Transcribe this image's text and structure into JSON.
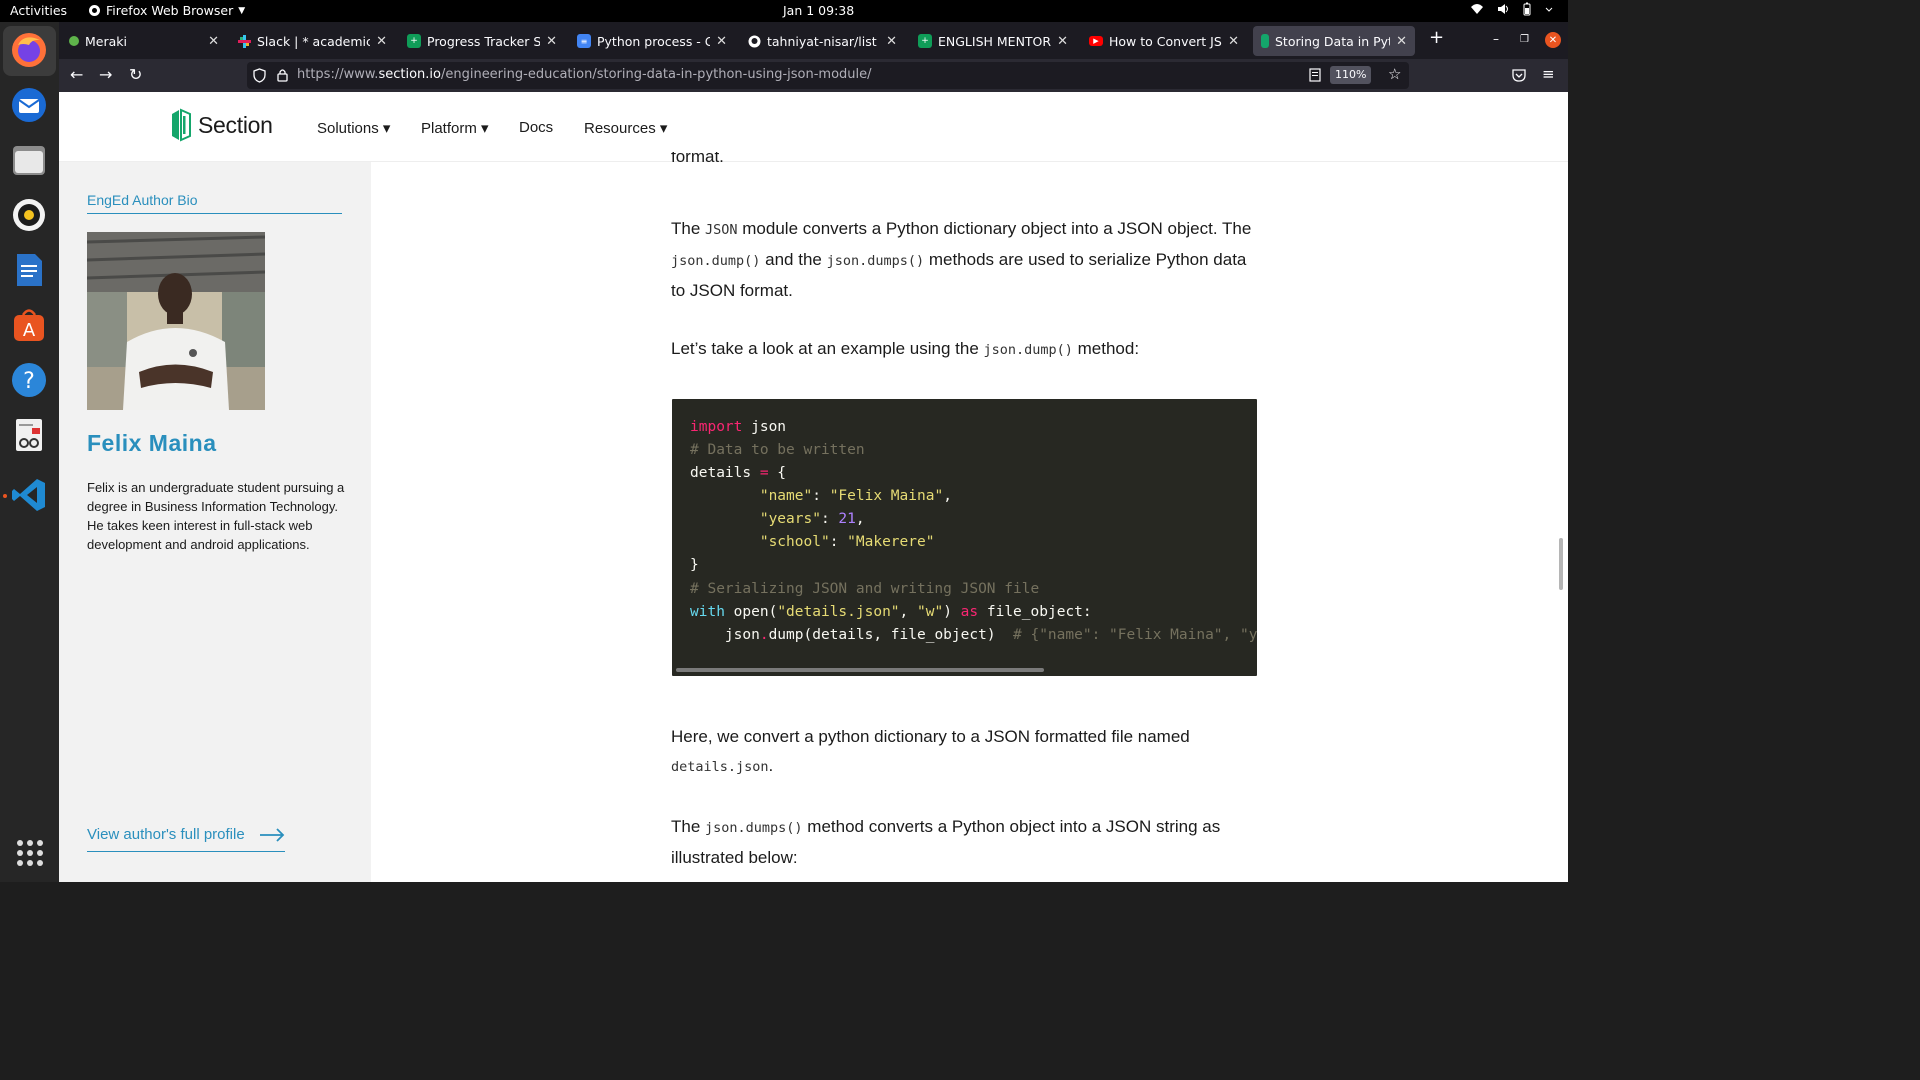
{
  "topbar": {
    "activities": "Activities",
    "app_menu": "Firefox Web Browser",
    "clock": "Jan 1  09:38"
  },
  "tabs": [
    {
      "label": "Meraki",
      "favicon_color": "#5fb44b"
    },
    {
      "label": "Slack | * academics | N",
      "favicon_color": "#e01e5a"
    },
    {
      "label": "Progress Tracker Shee",
      "favicon_color": "#0f9d58"
    },
    {
      "label": "Python process - Goog",
      "favicon_color": "#4285f4"
    },
    {
      "label": "tahniyat-nisar/list",
      "favicon_color": "#ffffff"
    },
    {
      "label": "ENGLISH MENTOR GR",
      "favicon_color": "#0f9d58"
    },
    {
      "label": "How to Convert JSON",
      "favicon_color": "#ff0000"
    },
    {
      "label": "Storing Data in Python",
      "favicon_color": "#14a66b"
    }
  ],
  "navbar": {
    "url_scheme": "https://www.",
    "url_host": "section.io",
    "url_path": "/engineering-education/storing-data-in-python-using-json-module/",
    "zoom": "110%"
  },
  "site": {
    "logo": "Section",
    "menu": {
      "solutions": "Solutions ▾",
      "platform": "Platform ▾",
      "docs": "Docs",
      "resources": "Resources ▾"
    }
  },
  "sidebar": {
    "bio_label": "EngEd Author Bio",
    "author_name": "Felix Maina",
    "author_bio": "Felix is an undergraduate student pursuing a degree in Business Information Technology. He takes keen interest in full-stack web development and android applications.",
    "profile_link": "View author's full profile"
  },
  "article": {
    "cut_line": "format.",
    "p1_a": "The ",
    "p1_code1": "JSON",
    "p1_b": " module converts a Python dictionary object into a JSON object. The ",
    "p1_code2": "json.dump()",
    "p1_c": " and the ",
    "p1_code3": "json.dumps()",
    "p1_d": " methods are used to serialize Python data to JSON format.",
    "p2_a": "Let’s take a look at an example using the ",
    "p2_code": "json.dump()",
    "p2_b": " method:",
    "p3_a": "Here, we convert a python dictionary to a JSON formatted file named ",
    "p3_code": "details.json",
    "p3_b": ".",
    "p4_a": "The ",
    "p4_code": "json.dumps()",
    "p4_b": " method converts a Python object into a JSON string as illustrated below:"
  },
  "code": {
    "l1_kw": "import",
    "l1_rest": " json",
    "l2": "# Data to be written",
    "l3_a": "details ",
    "l3_op": "=",
    "l3_b": " {",
    "l4_key": "\"name\"",
    "l4_val": "\"Felix Maina\"",
    "l5_key": "\"years\"",
    "l5_val": "21",
    "l6_key": "\"school\"",
    "l6_val": "\"Makerere\"",
    "l7": "}",
    "l8": "# Serializing JSON and writing JSON file",
    "l9_kw": "with",
    "l9_a": " open(",
    "l9_s1": "\"details.json\"",
    "l9_b": ", ",
    "l9_s2": "\"w\"",
    "l9_c": ") ",
    "l9_as": "as",
    "l9_d": " file_object:",
    "l10_a": "    json",
    "l10_dot": ".",
    "l10_b": "dump(details, file_object)  ",
    "l10_cm": "# {\"name\": \"Felix Maina\", \"ye"
  }
}
